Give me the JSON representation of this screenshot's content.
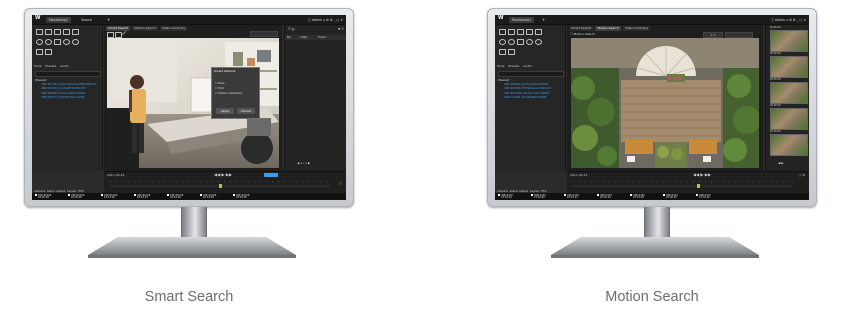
{
  "monitors": [
    {
      "caption": "Smart Search",
      "app": {
        "logo": "W",
        "tabs": [
          "Monitoring1",
          "Search"
        ],
        "add_tab": "+",
        "top_right": "ⓘ admin ⌂ ⚙ ⚙ _ □ ×",
        "panel_tabs": [
          "Tools",
          "Presets",
          "Audio"
        ],
        "device_tree": {
          "root": "Wisenet",
          "items": [
            "XNF-8010R_Smart(Wisenet)XNV-8081R",
            "XNP-6320H_ControlPTZ-XNO-83",
            "XNF-6080R_OutdoorXNV-6083R",
            "XNP-6321H_HQPTZ(XNO)-8280"
          ]
        },
        "search_tabs": [
          "Smart Search",
          "Motion Search",
          "Video summary"
        ],
        "dialog": {
          "title": "Smart Options",
          "options": [
            "Pass",
            "Exit",
            "Motion Detection"
          ],
          "apply": "Apply",
          "cancel": "Cancel"
        },
        "results_header": [
          "No.",
          "Date",
          "Event"
        ],
        "pager": "◀ 1 / 1 ▶",
        "timeline_time": "2017-03-23",
        "bottom_labels": [
          "Camera",
          "Alarm output",
          "Layout",
          "PTZ"
        ],
        "thumbs": [
          {
            "name": "XNF-8010R",
            "time": "18:00:28"
          },
          {
            "name": "XNF-8010R",
            "time": "16:00:28"
          },
          {
            "name": "XNF-8010R",
            "time": "18:53:20"
          },
          {
            "name": "XNF-8010R",
            "time": "18:53:24"
          },
          {
            "name": "XNF-8010R",
            "time": "18:54:28"
          },
          {
            "name": "XNF-8010R",
            "time": "18:54:28"
          },
          {
            "name": "XNF-8010R",
            "time": "18:55:00"
          }
        ]
      }
    },
    {
      "caption": "Motion Search",
      "app": {
        "logo": "W",
        "tabs": [
          "Monitoring1"
        ],
        "add_tab": "+",
        "top_right": "ⓘ admin ⌂ ⚙ ⚙ _ □ ×",
        "panel_tabs": [
          "Tools",
          "Presets",
          "Audio"
        ],
        "device_tree": {
          "root": "Wisenet",
          "items": [
            "XNV-8080R_OutdoorXNV-8081R",
            "XNP-6320H_PTZ(Wisenet)XNO-83",
            "XNF-8010RW_MotionXNV-6083R",
            "XNO-6120R_StreetXND-8080R"
          ]
        },
        "search_tabs": [
          "Smart Search",
          "Motion Search",
          "Video summary"
        ],
        "motion_label": "Motion Search",
        "zoom": "1 X",
        "thumbs_right": [
          "00:00:00",
          "00:00:00",
          "00:00:00",
          "00:00:00",
          "00:00:00"
        ],
        "pager": "◀ ▶",
        "timeline_time": "2017-03-23",
        "bottom_labels": [
          "Camera",
          "Alarm output",
          "Layout",
          "PTZ"
        ],
        "thumbs": [
          {
            "name": "XNP-6320",
            "time": "23:23:24"
          },
          {
            "name": "XNP-6320",
            "time": "21:45:02"
          },
          {
            "name": "XNP-6320",
            "time": "18:23:27"
          },
          {
            "name": "XNP-6320",
            "time": "20:36:24"
          },
          {
            "name": "XNP-6320",
            "time": "21:35:00"
          },
          {
            "name": "XNP-6320",
            "time": "22:00:52"
          },
          {
            "name": "XNP-6320",
            "time": "22:30:02"
          }
        ]
      }
    }
  ],
  "colors": {
    "accent": "#3c9be6",
    "panel": "#262626",
    "bezel": "#d6d9dc"
  }
}
